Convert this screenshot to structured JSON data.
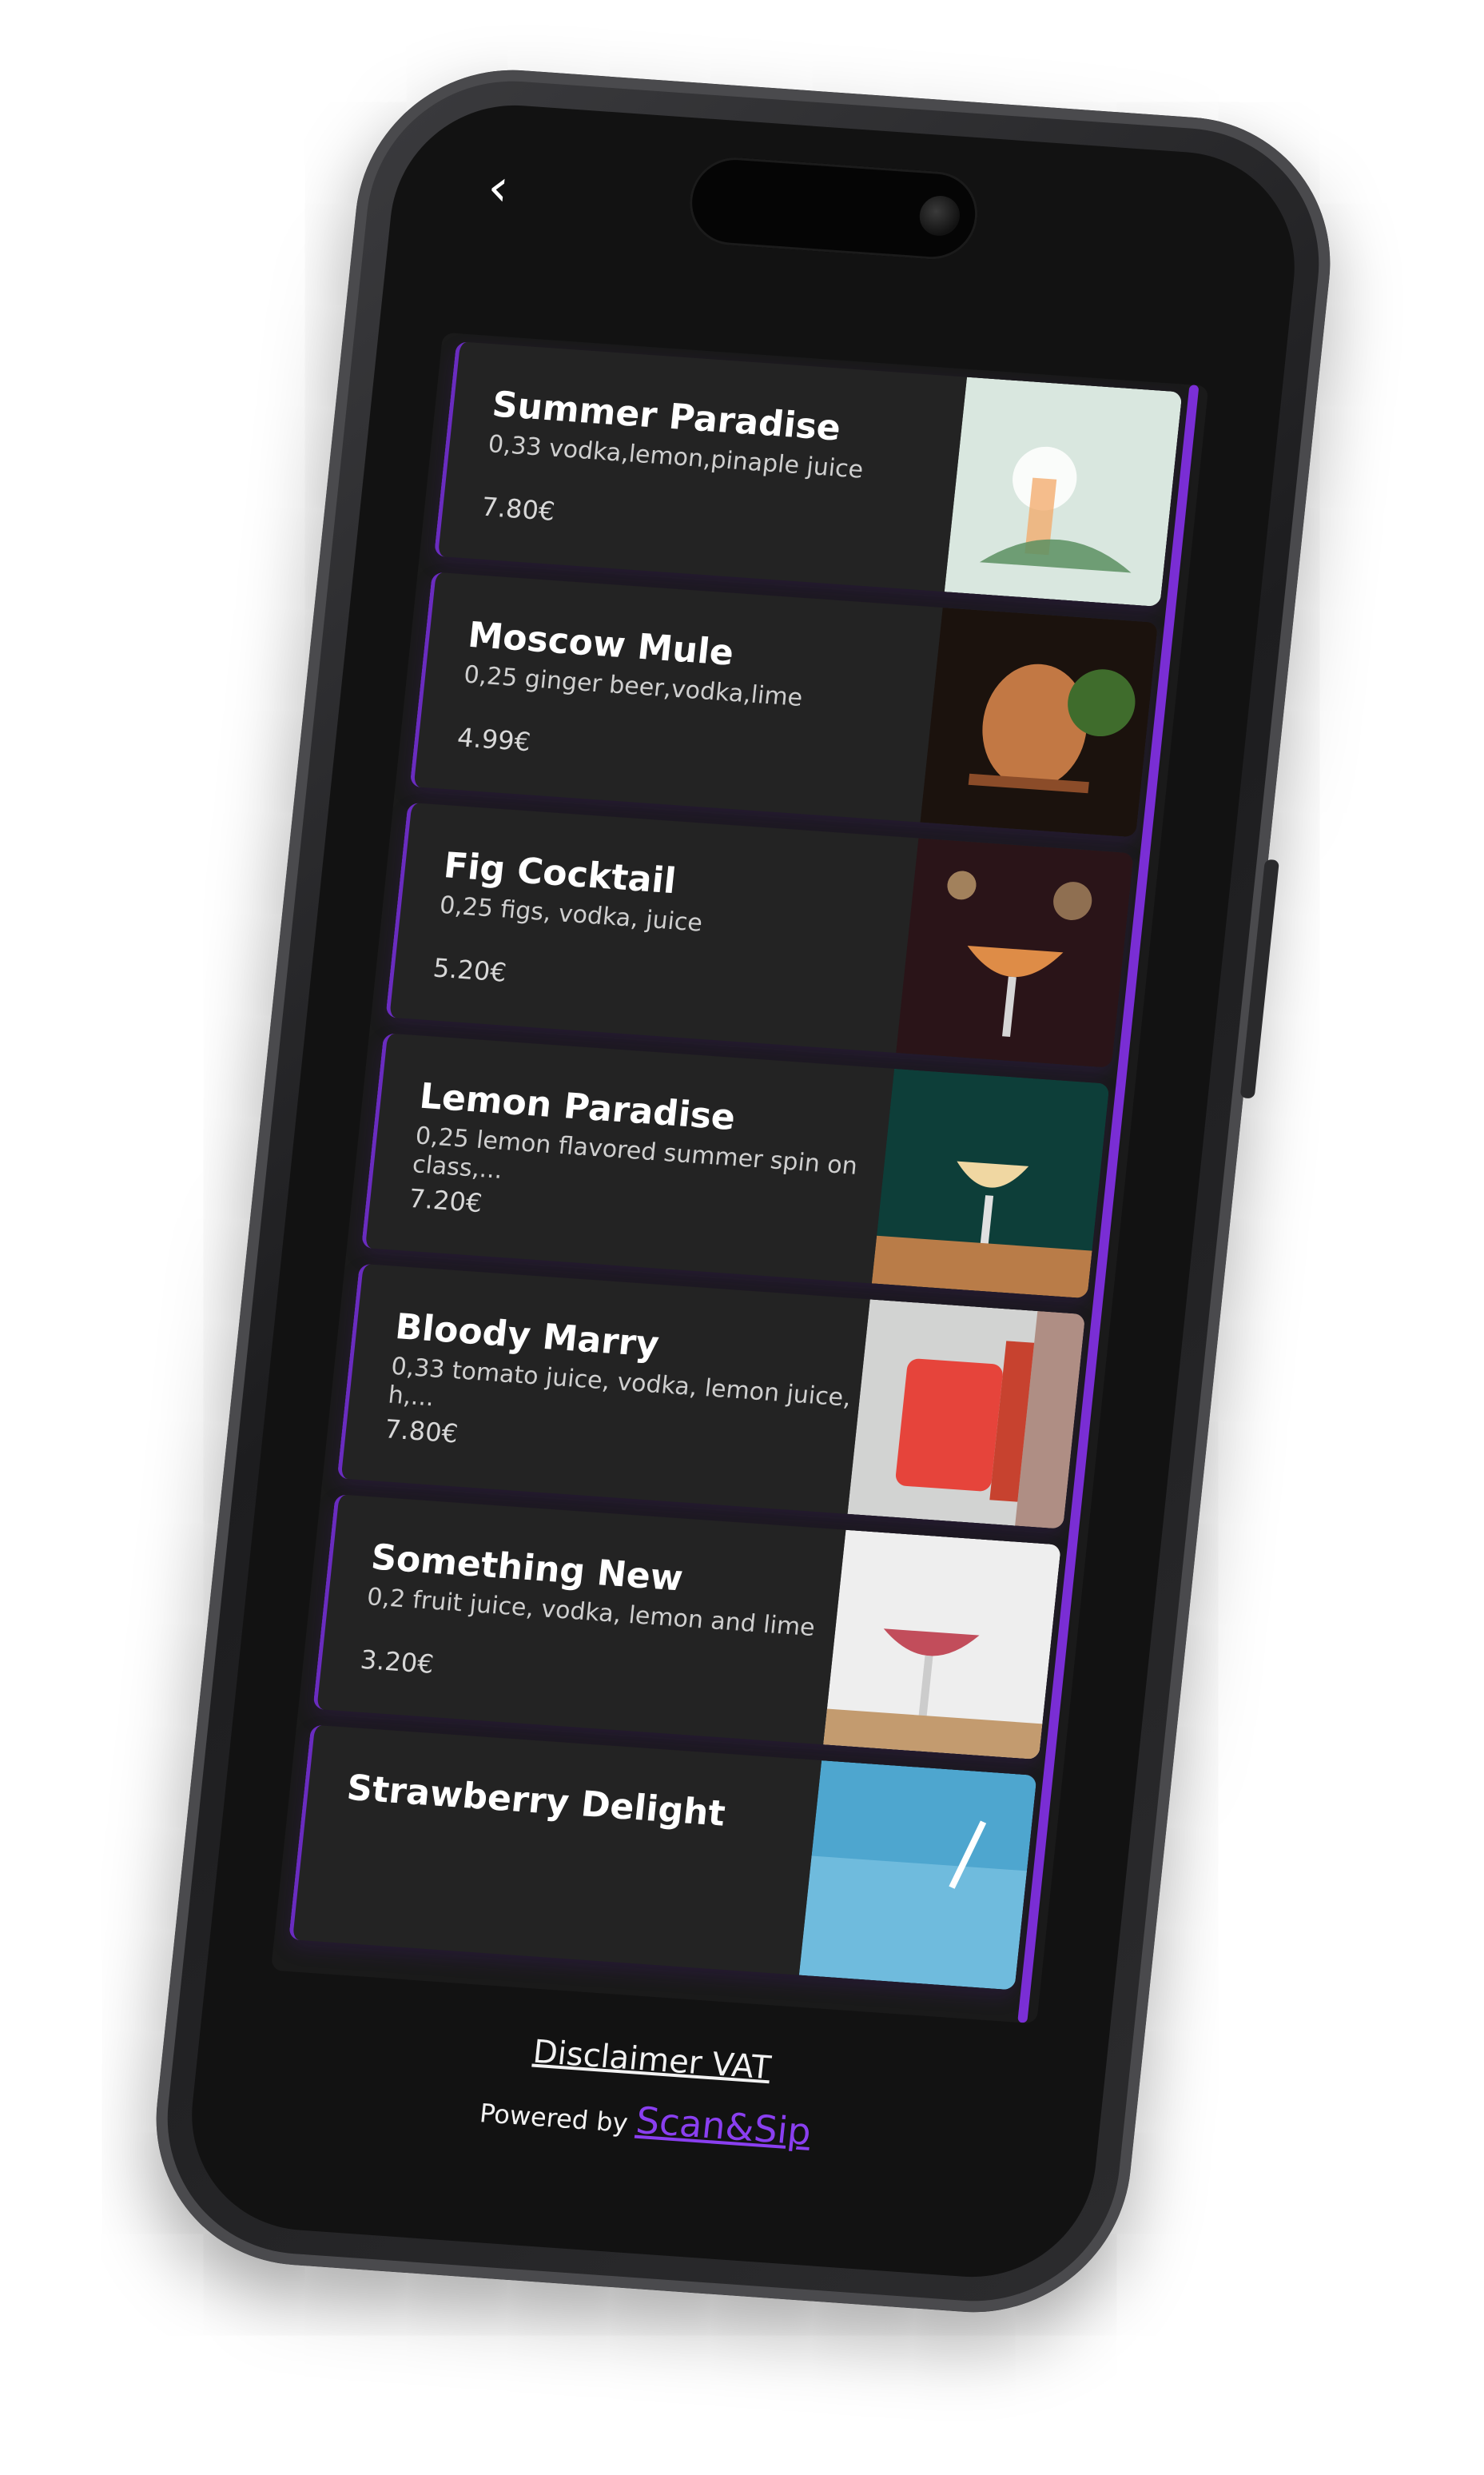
{
  "nav": {
    "back_icon": "chevron-left-icon"
  },
  "menu": {
    "items": [
      {
        "name": "Summer Paradise",
        "description": "0,33 vodka,lemon,pinaple juice",
        "price": "7.80€",
        "photo_colors": [
          "#d9e7df",
          "#f3a867",
          "#5b8f61"
        ]
      },
      {
        "name": "Moscow Mule",
        "description": "0,25 ginger beer,vodka,lime",
        "price": "4.99€",
        "photo_colors": [
          "#1b120d",
          "#c27844",
          "#3f6c2c"
        ]
      },
      {
        "name": "Fig Cocktail",
        "description": "0,25 figs, vodka, juice",
        "price": "5.20€",
        "photo_colors": [
          "#2a1418",
          "#de8c47",
          "#8f1b2e"
        ]
      },
      {
        "name": "Lemon Paradise",
        "description": "0,25 lemon flavored summer spin on class,...",
        "price": "7.20€",
        "photo_colors": [
          "#0d3e39",
          "#f0d7a2",
          "#b97c48"
        ]
      },
      {
        "name": "Bloody Marry",
        "description": "0,33 tomato juice, vodka, lemon juice, h,...",
        "price": "7.80€",
        "photo_colors": [
          "#d2d3d2",
          "#e6443b",
          "#8c4a35"
        ]
      },
      {
        "name": "Something New",
        "description": "0,2 fruit juice, vodka, lemon and lime",
        "price": "3.20€",
        "photo_colors": [
          "#eeeeee",
          "#c24d5b",
          "#c39b6f"
        ]
      },
      {
        "name": "Strawberry Delight",
        "description": "",
        "price": "",
        "photo_colors": [
          "#4ea6cf",
          "#8fd0ec",
          "#2c6c94"
        ]
      }
    ]
  },
  "footer": {
    "disclaimer": "Disclaimer VAT",
    "powered_by": "Powered by",
    "brand": "Scan&Sip"
  },
  "colors": {
    "accent": "#7b2fd6",
    "card": "#232323",
    "screen": "#121212"
  }
}
